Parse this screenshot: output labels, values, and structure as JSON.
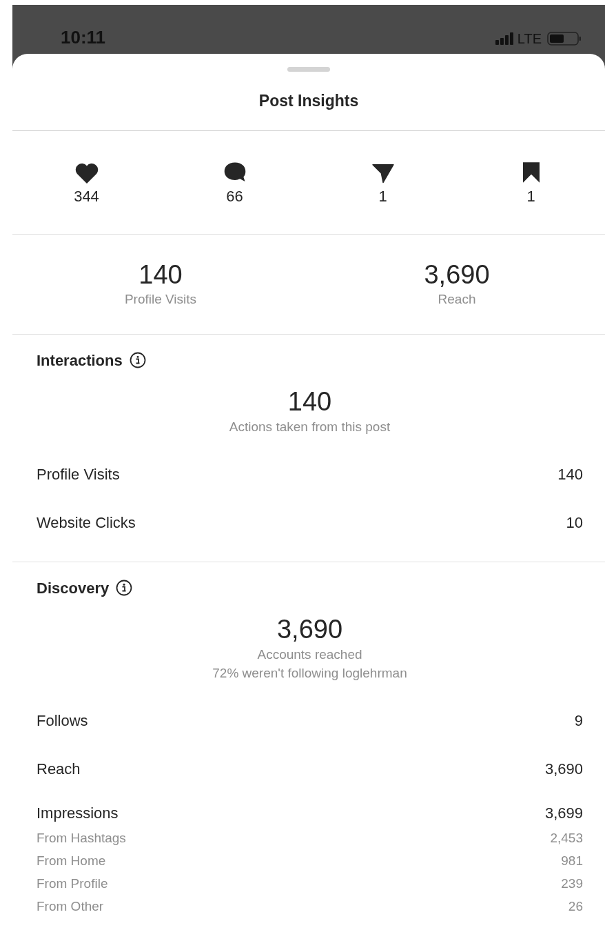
{
  "status_bar": {
    "time": "10:11",
    "network": "LTE"
  },
  "title": "Post Insights",
  "engagement": [
    {
      "kind": "likes",
      "count": "344"
    },
    {
      "kind": "comments",
      "count": "66"
    },
    {
      "kind": "shares",
      "count": "1"
    },
    {
      "kind": "saves",
      "count": "1"
    }
  ],
  "summary": [
    {
      "value": "140",
      "label": "Profile Visits"
    },
    {
      "value": "3,690",
      "label": "Reach"
    }
  ],
  "sections": [
    {
      "title": "Interactions",
      "total": "140",
      "captions": [
        "Actions taken from this post"
      ],
      "rows": [
        {
          "kind": "main",
          "label": "Profile Visits",
          "value": "140"
        },
        {
          "kind": "main",
          "label": "Website Clicks",
          "value": "10"
        }
      ]
    },
    {
      "title": "Discovery",
      "total": "3,690",
      "captions": [
        "Accounts reached",
        "72% weren't following loglehrman"
      ],
      "rows": [
        {
          "kind": "main",
          "label": "Follows",
          "value": "9"
        },
        {
          "kind": "main",
          "label": "Reach",
          "value": "3,690"
        },
        {
          "kind": "main",
          "label": "Impressions",
          "value": "3,699"
        },
        {
          "kind": "sub",
          "label": "From Hashtags",
          "value": "2,453"
        },
        {
          "kind": "sub",
          "label": "From Home",
          "value": "981"
        },
        {
          "kind": "sub",
          "label": "From Profile",
          "value": "239"
        },
        {
          "kind": "sub",
          "label": "From Other",
          "value": "26"
        }
      ]
    }
  ]
}
